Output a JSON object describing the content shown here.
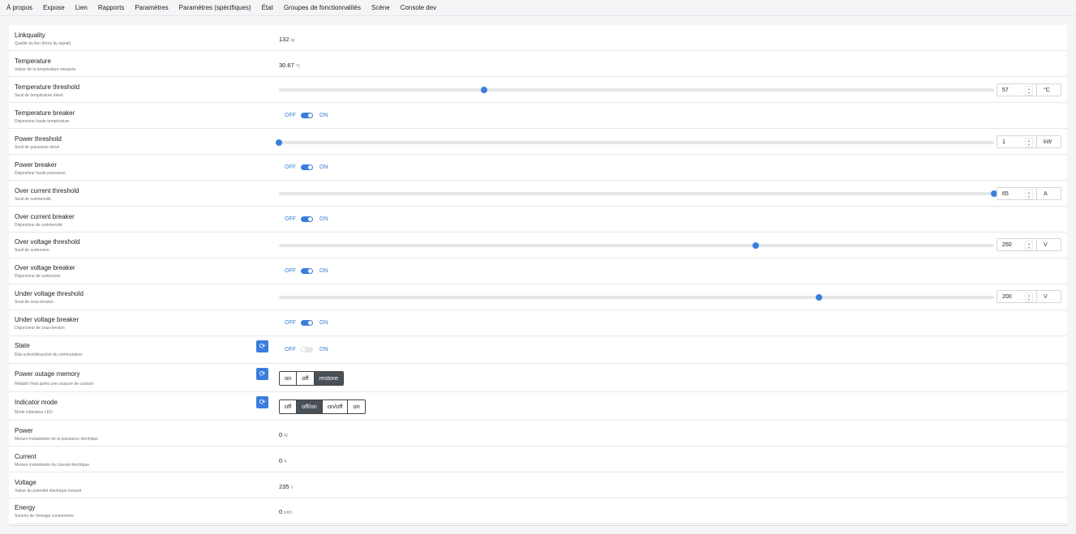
{
  "tabs": [
    "À propos",
    "Expose",
    "Lien",
    "Rapports",
    "Paramètres",
    "Paramètres (spécifiques)",
    "État",
    "Groupes de fonctionnalités",
    "Scène",
    "Console dev"
  ],
  "rows": {
    "linkquality": {
      "name": "Linkquality",
      "desc": "Qualité du lien (force du signal)",
      "value": "132",
      "unit": "lqi"
    },
    "temperature": {
      "name": "Temperature",
      "desc": "Valeur de la température mesurée",
      "value": "30.67",
      "unit": "°C"
    },
    "temperature_threshold": {
      "name": "Temperature threshold",
      "desc": "Seuil de température élevé",
      "value": "57",
      "unit": "°C",
      "fraction": 0.287
    },
    "temperature_breaker": {
      "name": "Temperature breaker",
      "desc": "Disjoncteur haute température",
      "off": "OFF",
      "on": "ON",
      "state": "on"
    },
    "power_threshold": {
      "name": "Power threshold",
      "desc": "Seuil de puissance élevé",
      "value": "1",
      "unit": "kW",
      "fraction": 0.0
    },
    "power_breaker": {
      "name": "Power breaker",
      "desc": "Disjoncteur haute puissance",
      "off": "OFF",
      "on": "ON",
      "state": "on"
    },
    "over_current_threshold": {
      "name": "Over current threshold",
      "desc": "Seuil de surintensité",
      "value": "65",
      "unit": "A",
      "fraction": 1.0
    },
    "over_current_breaker": {
      "name": "Over current breaker",
      "desc": "Disjoncteur de surintensité",
      "off": "OFF",
      "on": "ON",
      "state": "on"
    },
    "over_voltage_threshold": {
      "name": "Over voltage threshold",
      "desc": "Seuil de surtension",
      "value": "250",
      "unit": "V",
      "fraction": 0.667
    },
    "over_voltage_breaker": {
      "name": "Over voltage breaker",
      "desc": "Disjoncteur de surtension",
      "off": "OFF",
      "on": "ON",
      "state": "on"
    },
    "under_voltage_threshold": {
      "name": "Under voltage threshold",
      "desc": "Seuil de sous-tension",
      "value": "200",
      "unit": "V",
      "fraction": 0.755
    },
    "under_voltage_breaker": {
      "name": "Under voltage breaker",
      "desc": "Disjoncteur de sous-tension",
      "off": "OFF",
      "on": "ON",
      "state": "on"
    },
    "state": {
      "name": "State",
      "desc": "État activé/désactivé du commutateur",
      "off": "OFF",
      "on": "ON",
      "state": "off"
    },
    "power_outage_memory": {
      "name": "Power outage memory",
      "desc": "Rétablir l'état après une coupure de courant",
      "options": [
        "on",
        "off",
        "restore"
      ],
      "selected": "restore"
    },
    "indicator_mode": {
      "name": "Indicator mode",
      "desc": "Mode indicateur LED",
      "options": [
        "off",
        "off/on",
        "on/off",
        "on"
      ],
      "selected": "off/on"
    },
    "power": {
      "name": "Power",
      "desc": "Mesure instantanée de la puissance électrique",
      "value": "0",
      "unit": "W"
    },
    "current": {
      "name": "Current",
      "desc": "Mesure instantanée du courant électrique",
      "value": "0",
      "unit": "A"
    },
    "voltage": {
      "name": "Voltage",
      "desc": "Valeur du potentiel électrique mesuré",
      "value": "235",
      "unit": "V"
    },
    "energy": {
      "name": "Energy",
      "desc": "Somme de l'énergie consommée",
      "value": "0",
      "unit": "kWh"
    }
  },
  "icons": {
    "refresh": "refresh-icon",
    "spinner": "up-down-arrows"
  },
  "colors": {
    "accent": "#3b7ddd",
    "selected_button": "#495057"
  }
}
